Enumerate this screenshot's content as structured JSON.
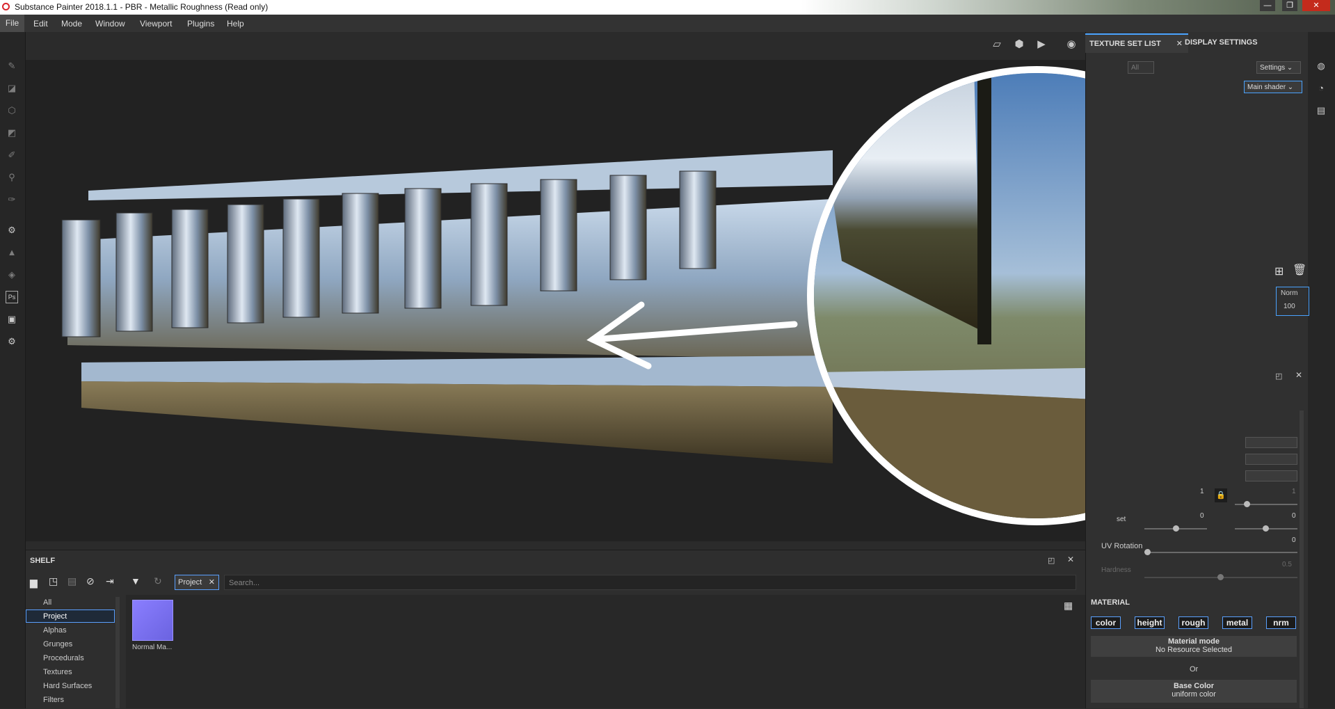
{
  "window": {
    "title": "Substance Painter 2018.1.1 - PBR - Metallic Roughness (Read only)",
    "min_glyph": "—",
    "max_glyph": "❐",
    "close_glyph": "✕"
  },
  "menu": [
    "File",
    "Edit",
    "Mode",
    "Window",
    "Viewport",
    "Plugins",
    "Help"
  ],
  "left_tools": [
    "paint-brush-icon",
    "eraser-icon",
    "projection-icon",
    "polygon-fill-icon",
    "smudge-icon",
    "clone-stamp-icon",
    "color-picker-icon",
    "substance-icon",
    "notification-icon",
    "layer-icon",
    "photoshop-icon",
    "export-icon",
    "settings-icon"
  ],
  "left_tools_ps_label": "Ps",
  "viewport": {
    "toolbar_icons": [
      "2d-view-icon",
      "3d-view-icon",
      "camera-icon",
      "screenshot-icon"
    ]
  },
  "texture_set_panel": {
    "tab_active": "TEXTURE SET LIST",
    "tab_close": "✕",
    "tab_other": "DISPLAY SETTINGS",
    "filter_all": "All",
    "settings_label": "Settings",
    "shader_label": "Main shader",
    "blend_mode": "Norm",
    "opacity": "100"
  },
  "properties": {
    "value_1": "1",
    "value_1b": "1",
    "offset_label": "set",
    "offset_x": "0",
    "offset_y": "0",
    "uv_rotation_label": "UV Rotation",
    "uv_rotation": "0",
    "hardness_label": "Hardness",
    "hardness": "0.5"
  },
  "material": {
    "title": "MATERIAL",
    "channels": [
      "color",
      "height",
      "rough",
      "metal",
      "nrm"
    ],
    "material_mode_label": "Material mode",
    "material_mode_value": "No Resource Selected",
    "or_label": "Or",
    "base_color_label": "Base Color",
    "base_color_value": "uniform color"
  },
  "shelf": {
    "title": "SHELF",
    "categories": [
      "All",
      "Project",
      "Alphas",
      "Grunges",
      "Procedurals",
      "Textures",
      "Hard Surfaces",
      "Filters"
    ],
    "selected_category": "Project",
    "filter_chip": "Project",
    "filter_chip_close": "✕",
    "search_placeholder": "Search...",
    "items": [
      {
        "label": "Normal Ma..."
      }
    ]
  },
  "colors": {
    "accent": "#4aa3ff",
    "panel": "#303030",
    "viewport": "#222222"
  }
}
